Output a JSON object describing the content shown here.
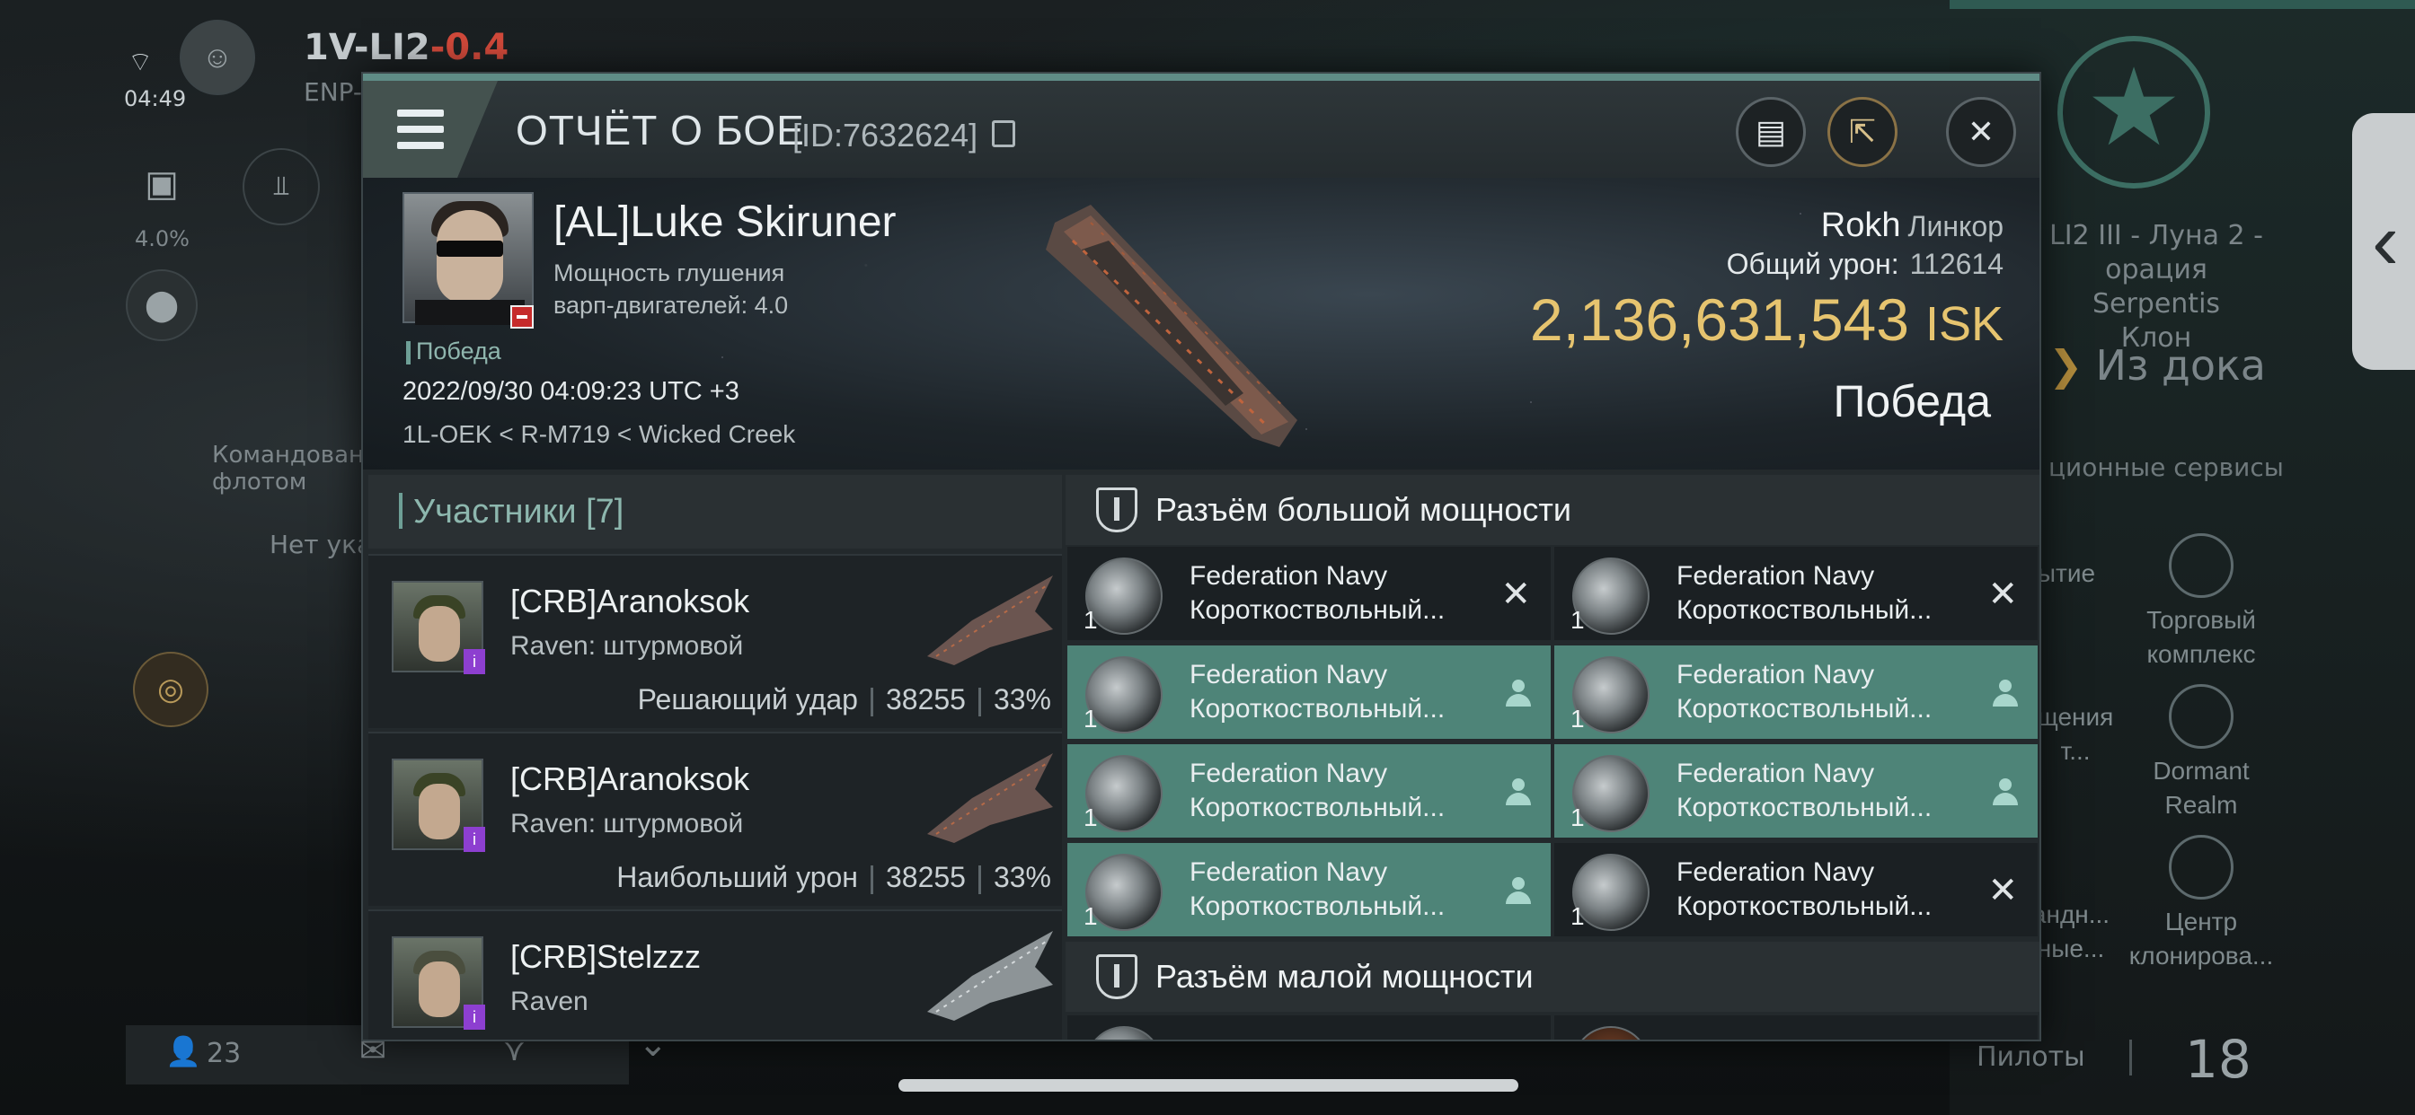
{
  "background": {
    "system_name": "1V-LI2",
    "security": "-0.4",
    "sub_label": "ENP-",
    "clock": "04:49",
    "percent": "4.0%",
    "fleet_label": "Командование флотом",
    "none_label": "Нет ука",
    "bottom_count": "23"
  },
  "right_bg": {
    "location_lines": [
      "LI2 III - Луна 2 -",
      "орация Serpentis",
      "Клон"
    ],
    "undock_label": "Из дока",
    "services_label": "ционные сервисы",
    "items": [
      {
        "label": "ытие"
      },
      {
        "label": "Торговый комплекс"
      },
      {
        "label": "щения т..."
      },
      {
        "label": "Dormant Realm"
      },
      {
        "label": "андн... ные..."
      },
      {
        "label": "Центр клонирова..."
      }
    ],
    "pilots_label": "Пилоты",
    "pilots_count": "18"
  },
  "dialog": {
    "title": "ОТЧЁТ О БОЕ",
    "report_id": "[ID:7632624]",
    "buttons": {
      "log": "log-icon",
      "share": "share-icon",
      "close": "close-icon"
    }
  },
  "victim": {
    "name": "[AL]Luke Skiruner",
    "attribute_line1": "Мощность глушения",
    "attribute_line2": "варп-двигателей: 4.0",
    "status": "Победа",
    "datetime": "2022/09/30 04:09:23 UTC +3",
    "location": "1L-OEK < R-M719 < Wicked Creek",
    "ship_name": "Rokh",
    "ship_class": "Линкор",
    "total_damage_label": "Общий урон:",
    "total_damage": "112614",
    "isk_value": "2,136,631,543",
    "isk_unit": "ISK",
    "result": "Победа"
  },
  "participants": {
    "header": "Участники [7]",
    "rows": [
      {
        "name": "[CRB]Aranoksok",
        "ship": "Raven: штурмовой",
        "role": "Решающий удар",
        "damage": "38255",
        "percent": "33%"
      },
      {
        "name": "[CRB]Aranoksok",
        "ship": "Raven: штурмовой",
        "role": "Наибольший урон",
        "damage": "38255",
        "percent": "33%"
      },
      {
        "name": "[CRB]Stelzzz",
        "ship": "Raven",
        "role": "",
        "damage": "",
        "percent": ""
      }
    ]
  },
  "slots": {
    "high": {
      "title": "Разъём большой мощности",
      "modules": [
        {
          "line1": "Federation Navy",
          "line2": "Короткоствольный...",
          "count": "1",
          "state": "destroyed"
        },
        {
          "line1": "Federation Navy",
          "line2": "Короткоствольный...",
          "count": "1",
          "state": "destroyed"
        },
        {
          "line1": "Federation Navy",
          "line2": "Короткоствольный...",
          "count": "1",
          "state": "dropped"
        },
        {
          "line1": "Federation Navy",
          "line2": "Короткоствольный...",
          "count": "1",
          "state": "dropped"
        },
        {
          "line1": "Federation Navy",
          "line2": "Короткоствольный...",
          "count": "1",
          "state": "dropped"
        },
        {
          "line1": "Federation Navy",
          "line2": "Короткоствольный...",
          "count": "1",
          "state": "dropped"
        },
        {
          "line1": "Federation Navy",
          "line2": "Короткоствольный...",
          "count": "1",
          "state": "dropped"
        },
        {
          "line1": "Federation Navy",
          "line2": "Короткоствольный...",
          "count": "1",
          "state": "destroyed"
        }
      ]
    },
    "low_title": "Разъём малой мощности"
  }
}
